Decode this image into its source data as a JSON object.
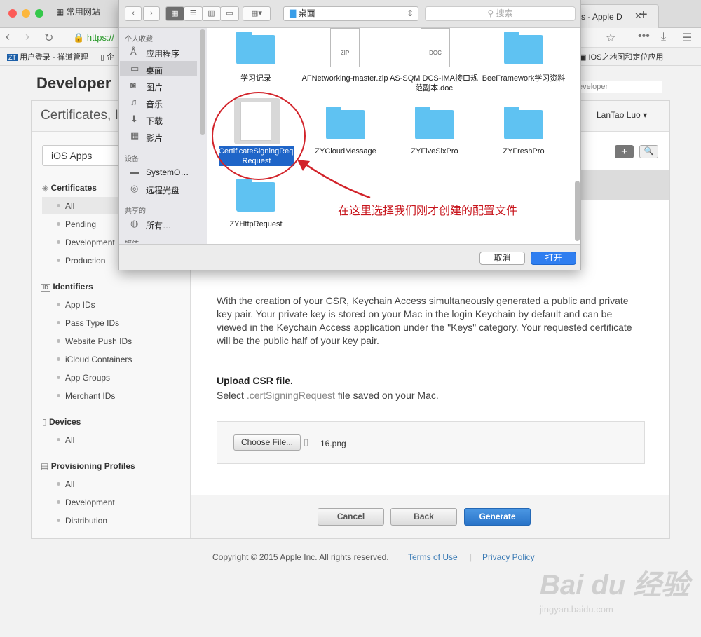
{
  "browser": {
    "tab_left": "常用网站",
    "tab_right": "s - Apple D",
    "url": "https://",
    "bookmarks": [
      "用户登录 - 禅道管理",
      "企",
      "IOS之地图和定位应用"
    ]
  },
  "page": {
    "brand": "Developer",
    "search_placeholder": "eveloper",
    "panel_title": "Certificates, I",
    "user": "LanTao Luo",
    "platform_select": "iOS Apps",
    "sidebar": {
      "certificates": {
        "title": "Certificates",
        "items": [
          "All",
          "Pending",
          "Development",
          "Production"
        ]
      },
      "identifiers": {
        "title": "Identifiers",
        "items": [
          "App IDs",
          "Pass Type IDs",
          "Website Push IDs",
          "iCloud Containers",
          "App Groups",
          "Merchant IDs"
        ]
      },
      "devices": {
        "title": "Devices",
        "items": [
          "All"
        ]
      },
      "profiles": {
        "title": "Provisioning Profiles",
        "items": [
          "All",
          "Development",
          "Distribution"
        ]
      }
    },
    "description": "With the creation of your CSR, Keychain Access simultaneously generated a public and private key pair. Your private key is stored on your Mac in the login Keychain by default and can be viewed in the Keychain Access application under the \"Keys\" category. Your requested certificate will be the public half of your key pair.",
    "upload_title": "Upload CSR file.",
    "upload_sub_pre": "Select ",
    "upload_sub_ext": ".certSigningRequest",
    "upload_sub_post": " file saved on your Mac.",
    "choose_file": "Choose File...",
    "file_name": "16.png",
    "buttons": {
      "cancel": "Cancel",
      "back": "Back",
      "generate": "Generate"
    },
    "copyright": "Copyright © 2015 Apple Inc. All rights reserved.",
    "terms": "Terms of Use",
    "privacy": "Privacy Policy",
    "watermark": "Bai du 经验",
    "watermark_url": "jingyan.baidu.com"
  },
  "dialog": {
    "location": "桌面",
    "search_placeholder": "搜索",
    "sidebar": {
      "favorites_header": "个人收藏",
      "favorites": [
        "应用程序",
        "桌面",
        "图片",
        "音乐",
        "下载",
        "影片"
      ],
      "devices_header": "设备",
      "devices": [
        "SystemO…",
        "远程光盘"
      ],
      "shared_header": "共享的",
      "shared": [
        "所有…"
      ],
      "media_header": "媒体"
    },
    "files": {
      "row1": [
        "学习记录",
        "AFNetworking-master.zip",
        "AS-SQM DCS-IMA接口规范副本.doc",
        "BeeFramework学习资料"
      ],
      "row2_selected": "CertificateSigningRequest.c…Request",
      "row2": [
        "ZYCloudMessage",
        "ZYFiveSixPro",
        "ZYFreshPro"
      ],
      "row3": [
        "ZYHttpRequest"
      ]
    },
    "cancel": "取消",
    "open": "打开",
    "annotation": "在这里选择我们刚才创建的配置文件"
  }
}
